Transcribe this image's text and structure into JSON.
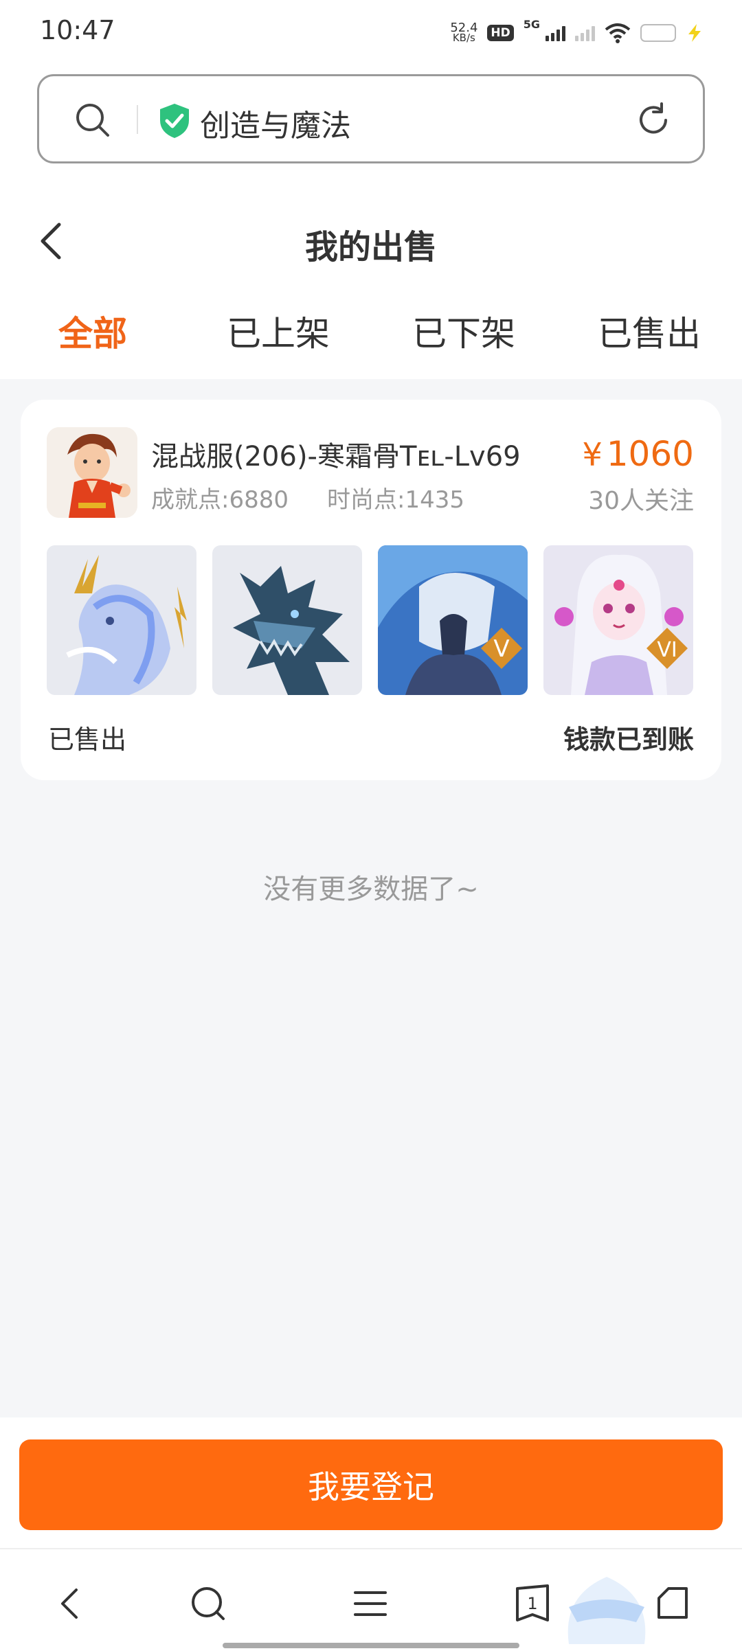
{
  "status_bar": {
    "time": "10:47",
    "net_speed_value": "52.4",
    "net_speed_unit": "KB/s",
    "hd_label": "HD",
    "network_label": "5G",
    "battery_color": "#2fd24b"
  },
  "address_bar": {
    "site_name": "创造与魔法",
    "icons": [
      "search-icon",
      "shield-check-icon",
      "refresh-icon"
    ]
  },
  "header": {
    "title": "我的出售",
    "tabs": [
      {
        "label": "全部",
        "active": true
      },
      {
        "label": "已上架",
        "active": false
      },
      {
        "label": "已下架",
        "active": false
      },
      {
        "label": "已售出",
        "active": false
      }
    ]
  },
  "listing": {
    "title": "混战服(206)-寒霜骨Tᴇʟ-Lv69",
    "achievement": "成就点:6880",
    "fashion": "时尚点:1435",
    "currency": "¥",
    "price": "1060",
    "watchers": "30人关注",
    "thumbnails": [
      {
        "name": "lightning-horse-mount",
        "badge": ""
      },
      {
        "name": "frost-dragon-pet",
        "badge": ""
      },
      {
        "name": "armored-hero-skin",
        "badge": "V"
      },
      {
        "name": "white-hair-doll-skin",
        "badge": "VI"
      }
    ],
    "status": "已售出",
    "payment_status": "钱款已到账"
  },
  "footer_text": "没有更多数据了~",
  "register_button": "我要登记",
  "browser_nav": {
    "tab_count": "1",
    "icons": [
      "back-icon",
      "search-icon",
      "menu-icon",
      "tabs-icon",
      "home-icon"
    ]
  },
  "colors": {
    "accent": "#f06418",
    "button": "#ff6a0f",
    "page_bg": "#f5f6f8"
  }
}
